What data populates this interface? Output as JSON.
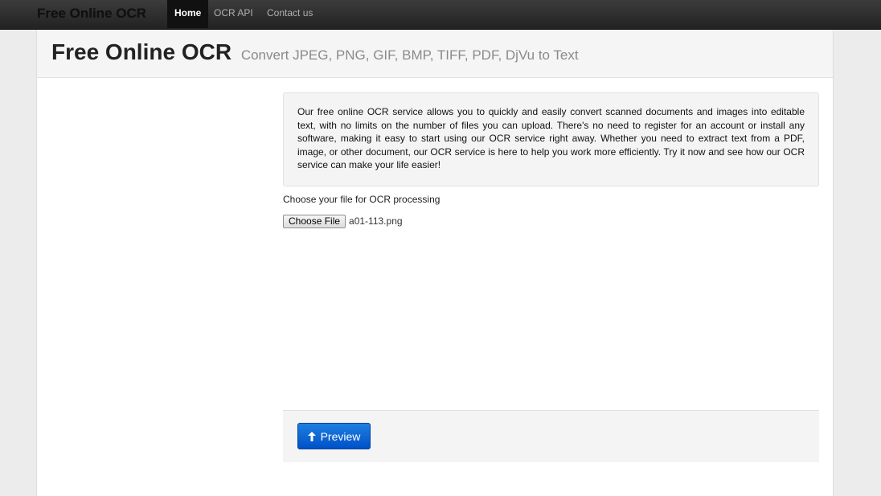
{
  "navbar": {
    "brand": "Free Online OCR",
    "items": [
      {
        "label": "Home",
        "active": true
      },
      {
        "label": "OCR API",
        "active": false
      },
      {
        "label": "Contact us",
        "active": false
      }
    ]
  },
  "header": {
    "title": "Free Online OCR",
    "subtitle": "Convert JPEG, PNG, GIF, BMP, TIFF, PDF, DjVu to Text"
  },
  "intro": {
    "text": "Our free online OCR service allows you to quickly and easily convert scanned documents and images into editable text, with no limits on the number of files you can upload. There's no need to register for an account or install any software, making it easy to start using our OCR service right away. Whether you need to extract text from a PDF, image, or other document, our OCR service is here to help you work more efficiently. Try it now and see how our OCR service can make your life easier!"
  },
  "upload": {
    "label": "Choose your file for OCR processing",
    "button_label": "Choose File",
    "file_name": "a01-113.png"
  },
  "actions": {
    "preview_label": "Preview",
    "preview_icon": "arrow-up-icon"
  },
  "colors": {
    "accent": "#0a66d8",
    "navbar": "#2b2b2b"
  }
}
